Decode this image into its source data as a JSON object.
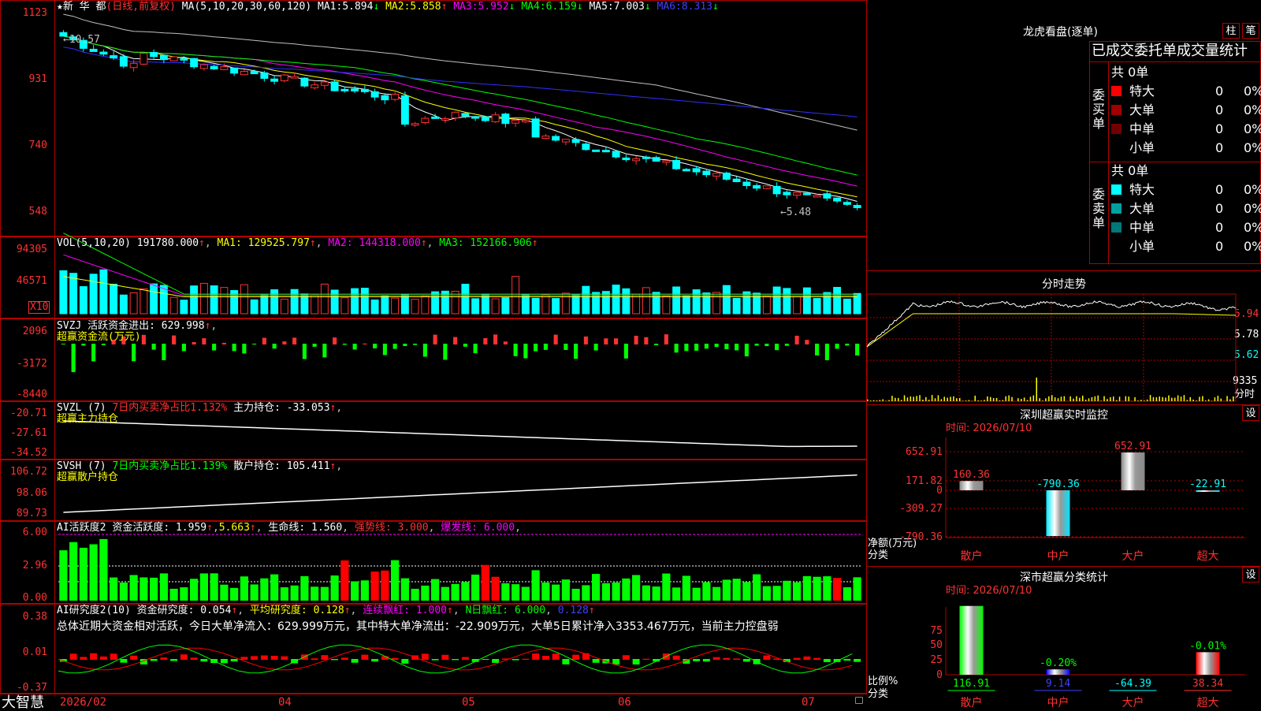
{
  "header": {
    "star": "★",
    "stock_name": "新 华 都",
    "period": "(日线,前复权)",
    "ma_params": "MA(5,10,20,30,60,120)",
    "ma": [
      {
        "label": "MA1:",
        "value": "5.894",
        "arrow": "↓"
      },
      {
        "label": "MA2:",
        "value": "5.858",
        "arrow": "↑"
      },
      {
        "label": "MA3:",
        "value": "5.952",
        "arrow": "↓"
      },
      {
        "label": "MA4:",
        "value": "6.159",
        "arrow": "↓"
      },
      {
        "label": "MA5:",
        "value": "7.003",
        "arrow": "↓"
      },
      {
        "label": "MA6:",
        "value": "8.313",
        "arrow": "↓"
      }
    ]
  },
  "main_chart": {
    "y_ticks": [
      "1123",
      "931",
      "740",
      "548"
    ],
    "high_label": "←10.57",
    "low_label": "←5.48",
    "high_price": 10.57,
    "low_price": 5.48
  },
  "vol_panel": {
    "title": "VOL(5,10,20)",
    "value": "191780.000",
    "ma1": "MA1: 129525.797",
    "ma2": "MA2: 144318.000",
    "ma3": "MA3: 152166.906",
    "y_ticks": [
      "94305",
      "46571"
    ],
    "unit": "X10"
  },
  "svzj_panel": {
    "title": "SVZJ",
    "label": "活跃资金进出:",
    "value": "629.998",
    "subtitle": "超赢资金流(万元)",
    "y_ticks": [
      "2096",
      "-3172",
      "-8440"
    ]
  },
  "svzl_panel": {
    "title": "SVZL (7)",
    "label1": "7日内买卖净占比1.132%",
    "label2": "主力持仓:",
    "value": "-33.053",
    "subtitle": "超赢主力持仓",
    "y_ticks": [
      "-20.71",
      "-27.61",
      "-34.52"
    ]
  },
  "svsh_panel": {
    "title": "SVSH (7)",
    "label1": "7日内买卖净占比1.139%",
    "label2": "散户持仓:",
    "value": "105.411",
    "subtitle": "超赢散户持仓",
    "y_ticks": [
      "106.72",
      "98.06",
      "89.73"
    ]
  },
  "ai_active_panel": {
    "title": "AI活跃度2",
    "label1": "资金活跃度:",
    "v1": "1.959",
    "v2": "5.663",
    "label3": "生命线:",
    "v3": "1.560",
    "label4": "强势线:",
    "v4": "3.000",
    "label5": "爆发线:",
    "v5": "6.000",
    "y_ticks": [
      "6.00",
      "2.96",
      "0.00"
    ]
  },
  "ai_research_panel": {
    "title": "AI研究度2(10)",
    "label1": "资金研究度:",
    "v1": "0.054",
    "label2": "平均研究度:",
    "v2": "0.128",
    "label3": "连续飘红:",
    "v3": "1.000",
    "label4": "N日飘红:",
    "v4": "6.000",
    "v5": "0.128",
    "summary": "总体近期大资金相对活跃，今日大单净流入：629.999万元，其中特大单净流出：-22.909万元，大单5日累计净入3353.467万元，当前主力控盘弱",
    "y_ticks": [
      "0.38",
      "0.01",
      "-0.37"
    ]
  },
  "x_axis": {
    "logo": "大智慧",
    "labels": [
      "2026/02",
      "04",
      "05",
      "06",
      "07"
    ]
  },
  "longhu": {
    "title": "龙虎看盘(逐单)",
    "btn1": "柱",
    "btn2": "笔",
    "header": "已成交委托单成交量统计",
    "buy_label": "委买单",
    "sell_label": "委卖单",
    "buy_total": "共 0单",
    "sell_total": "共 0单",
    "buy_rows": [
      {
        "name": "特大",
        "count": "0",
        "pct": "0%",
        "color": "#ff0000"
      },
      {
        "name": "大单",
        "count": "0",
        "pct": "0%",
        "color": "#a00000"
      },
      {
        "name": "中单",
        "count": "0",
        "pct": "0%",
        "color": "#700000"
      },
      {
        "name": "小单",
        "count": "0",
        "pct": "0%",
        "color": ""
      }
    ],
    "sell_rows": [
      {
        "name": "特大",
        "count": "0",
        "pct": "0%",
        "color": "#00ffff"
      },
      {
        "name": "大单",
        "count": "0",
        "pct": "0%",
        "color": "#00a0a0"
      },
      {
        "name": "中单",
        "count": "0",
        "pct": "0%",
        "color": "#007878"
      },
      {
        "name": "小单",
        "count": "0",
        "pct": "0%",
        "color": ""
      }
    ]
  },
  "intraday": {
    "title": "分时走势",
    "price_ticks": [
      "5.94",
      "5.78",
      "5.62"
    ],
    "vol_tick": "9335",
    "vol_unit": "分时"
  },
  "sz_monitor": {
    "title": "深圳超赢实时监控",
    "btn": "设",
    "time": "时间: 2026/07/10",
    "y_ticks": [
      "652.91",
      "171.82",
      "0",
      "-309.27",
      "-790.36"
    ],
    "y_label1": "净额(万元)",
    "y_label2": "分类",
    "categories": [
      "散户",
      "中户",
      "大户",
      "超大"
    ],
    "values": [
      160.36,
      -790.36,
      652.91,
      -22.91
    ],
    "value_labels": [
      "160.36",
      "-790.36",
      "652.91",
      "-22.91"
    ]
  },
  "sz_class": {
    "title": "深市超赢分类统计",
    "btn": "设",
    "time": "时间: 2026/07/10",
    "y_ticks": [
      "75",
      "50",
      "25",
      "0"
    ],
    "y_label1": "比例%",
    "y_label2": "分类",
    "categories": [
      "散户",
      "中户",
      "大户",
      "超大"
    ],
    "values": [
      116.91,
      9.14,
      -64.39,
      38.34
    ],
    "value_labels": [
      "116.91",
      "9.14",
      "-64.39",
      "38.34"
    ],
    "change_labels": [
      "",
      "-0.20%",
      "",
      "-0.01%"
    ]
  },
  "chart_data": [
    {
      "type": "candlestick",
      "title": "新华都 日线 前复权",
      "x_labels": [
        "2026/02",
        "04",
        "05",
        "06",
        "07"
      ],
      "y_ticks": [
        "1123",
        "931",
        "740",
        "548"
      ],
      "annotations": [
        "←10.57",
        "←5.48"
      ],
      "series": [
        {
          "name": "MA1",
          "value": 5.894
        },
        {
          "name": "MA2",
          "value": 5.858
        },
        {
          "name": "MA3",
          "value": 5.952
        },
        {
          "name": "MA4",
          "value": 6.159
        },
        {
          "name": "MA5",
          "value": 7.003
        },
        {
          "name": "MA6",
          "value": 8.313
        }
      ]
    },
    {
      "type": "bar",
      "title": "深圳超赢实时监控",
      "categories": [
        "散户",
        "中户",
        "大户",
        "超大"
      ],
      "values": [
        160.36,
        -790.36,
        652.91,
        -22.91
      ],
      "ylabel": "净额(万元)",
      "ylim": [
        -790.36,
        652.91
      ]
    },
    {
      "type": "bar",
      "title": "深市超赢分类统计",
      "categories": [
        "散户",
        "中户",
        "大户",
        "超大"
      ],
      "values": [
        116.91,
        9.14,
        -64.39,
        38.34
      ],
      "ylabel": "比例%",
      "ylim": [
        0,
        75
      ]
    }
  ]
}
